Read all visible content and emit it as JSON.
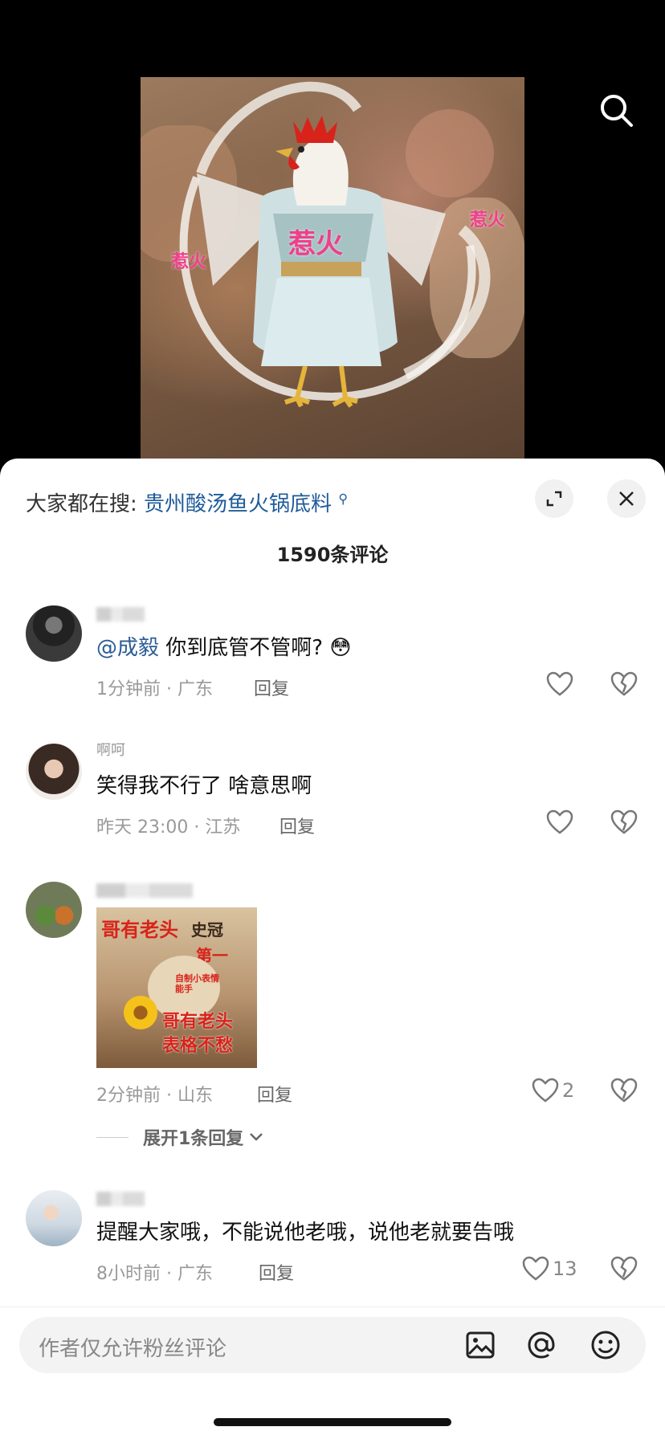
{
  "media": {
    "overlay_big": "惹火",
    "overlay_left": "惹火",
    "overlay_right": "惹火"
  },
  "sheet": {
    "search_prefix": "大家都在搜:",
    "search_keyword": "贵州酸汤鱼火锅底料",
    "comment_count": "1590条评论"
  },
  "comments": [
    {
      "mention": "@成毅",
      "text": "你到底管不管啊?",
      "emoji": "😳",
      "meta": "1分钟前 · 广东",
      "reply": "回复",
      "likes": ""
    },
    {
      "username": "啊呵",
      "text": "笑得我不行了 啥意思啊",
      "meta": "昨天 23:00 · 江苏",
      "reply": "回复",
      "likes": ""
    },
    {
      "sticker_lines": [
        "哥有老头",
        "史冠",
        "第一",
        "自制小表情能手",
        "哥有老头",
        "表格不愁"
      ],
      "meta": "2分钟前 · 山东",
      "reply": "回复",
      "likes": "2",
      "expand": "展开1条回复"
    },
    {
      "text": "提醒大家哦，不能说他老哦，说他老就要告哦",
      "meta": "8小时前 · 广东",
      "reply": "回复",
      "likes": "13"
    }
  ],
  "input": {
    "placeholder": "作者仅允许粉丝评论"
  },
  "colors": {
    "keyword_link": "#1f5b9a",
    "mention": "#2a5c93",
    "overlay_pink": "#ef3f8c",
    "sticker_red": "#d8231a"
  }
}
